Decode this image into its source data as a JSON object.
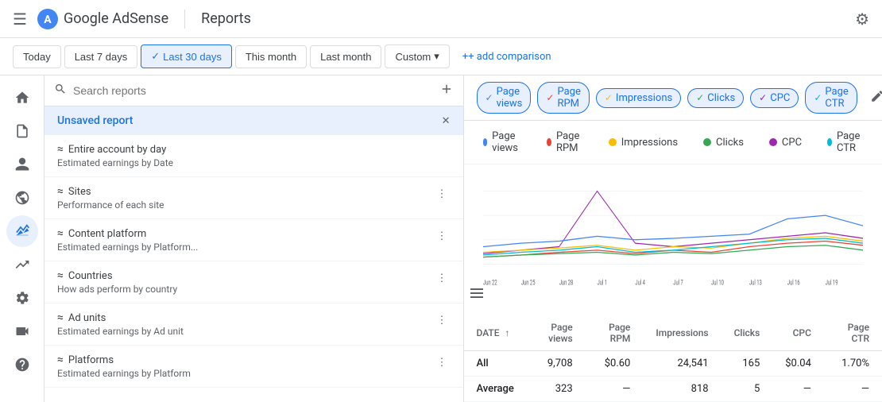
{
  "topNav": {
    "hamburger": "☰",
    "logoText": "Google AdSense",
    "pageTitle": "Reports",
    "settingsIcon": "⚙"
  },
  "filterBar": {
    "buttons": [
      {
        "label": "Today",
        "active": false
      },
      {
        "label": "Last 7 days",
        "active": false
      },
      {
        "label": "Last 30 days",
        "active": true
      },
      {
        "label": "This month",
        "active": false
      },
      {
        "label": "Last month",
        "active": false
      },
      {
        "label": "Custom",
        "active": false,
        "dropdown": true
      }
    ],
    "addComparison": "+ add comparison"
  },
  "sidebar": {
    "searchPlaceholder": "Search reports",
    "unsavedReport": "Unsaved report",
    "reports": [
      {
        "name": "Entire account by day",
        "desc": "Estimated earnings by Date"
      },
      {
        "name": "Sites",
        "desc": "Performance of each site"
      },
      {
        "name": "Content platform",
        "desc": "Estimated earnings by Platform..."
      },
      {
        "name": "Countries",
        "desc": "How ads perform by country"
      },
      {
        "name": "Ad units",
        "desc": "Estimated earnings by Ad unit"
      },
      {
        "name": "Platforms",
        "desc": "Estimated earnings by Platform"
      }
    ]
  },
  "metricTabs": [
    {
      "label": "Page views",
      "active": true
    },
    {
      "label": "Page RPM",
      "active": true
    },
    {
      "label": "Impressions",
      "active": true
    },
    {
      "label": "Clicks",
      "active": true
    },
    {
      "label": "CPC",
      "active": true
    },
    {
      "label": "Page CTR",
      "active": true
    }
  ],
  "legend": [
    {
      "label": "Page views",
      "color": "#4285f4"
    },
    {
      "label": "Page RPM",
      "color": "#ea4335"
    },
    {
      "label": "Impressions",
      "color": "#fbbc04"
    },
    {
      "label": "Clicks",
      "color": "#34a853"
    },
    {
      "label": "CPC",
      "color": "#9c27b0"
    },
    {
      "label": "Page CTR",
      "color": "#00bcd4"
    }
  ],
  "chartLabels": [
    "Jun 22",
    "Jun 25",
    "Jun 28",
    "Jul 1",
    "Jul 4",
    "Jul 7",
    "Jul 10",
    "Jul 13",
    "Jul 16",
    "Jul 19"
  ],
  "table": {
    "columns": [
      "DATE",
      "Page views",
      "Page RPM",
      "Impressions",
      "Clicks",
      "CPC",
      "Page CTR"
    ],
    "rows": [
      {
        "date": "All",
        "pageViews": "9,708",
        "pageRpm": "$0.60",
        "impressions": "24,541",
        "clicks": "165",
        "cpc": "$0.04",
        "ctr": "1.70%"
      },
      {
        "date": "Average",
        "pageViews": "323",
        "pageRpm": "—",
        "impressions": "818",
        "clicks": "5",
        "cpc": "—",
        "ctr": "—"
      }
    ]
  }
}
